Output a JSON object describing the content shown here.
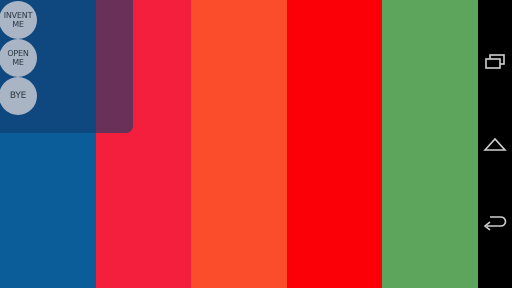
{
  "stripes": [
    {
      "name": "stripe-blue",
      "color": "#0a5d98"
    },
    {
      "name": "stripe-crimson",
      "color": "#f41f3c"
    },
    {
      "name": "stripe-orange",
      "color": "#fb4c2c"
    },
    {
      "name": "stripe-red",
      "color": "#fb0006"
    },
    {
      "name": "stripe-green",
      "color": "#5da55d"
    }
  ],
  "menu": {
    "invent_label": "INVENT ME",
    "open_label": "OPEN ME",
    "bye_label": "BYE"
  },
  "navbar": {
    "recents_icon": "recent-apps-icon",
    "home_icon": "home-icon",
    "back_icon": "back-icon"
  },
  "colors": {
    "panel_overlay": "#143c6e",
    "button_fill": "#a9b5c4",
    "navbar_bg": "#000000",
    "nav_icon": "#cfcfcf"
  }
}
